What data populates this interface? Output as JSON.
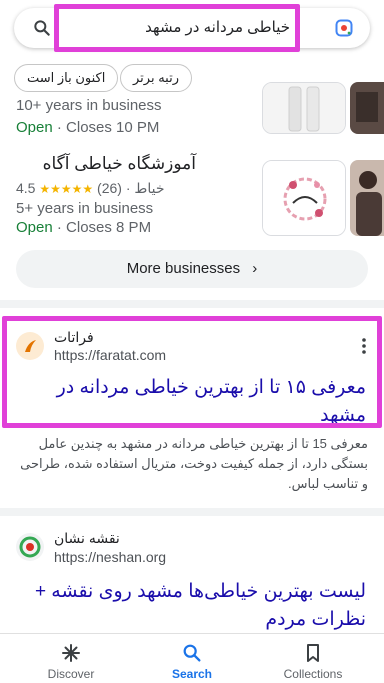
{
  "search": {
    "query": "خیاطی مردانه در مشهد",
    "icon": "search-icon",
    "lens_icon": "google-lens-icon"
  },
  "chips": [
    {
      "label": "اکنون باز است"
    },
    {
      "label": "رتبه برتر"
    }
  ],
  "businesses": [
    {
      "years": "10+ years in business",
      "open_status": "Open",
      "closes": " · Closes 10 PM"
    },
    {
      "name": "آموزشگاه خیاطی آگاه",
      "rating": "4.5",
      "stars": "★★★★★",
      "reviews": "(26)",
      "category": "· خیاط",
      "years": "5+ years in business",
      "open_status": "Open",
      "closes": " · Closes 8 PM"
    }
  ],
  "more_businesses": {
    "label": "More businesses",
    "icon": "chevron-right-icon"
  },
  "results": [
    {
      "site_name": "فراتات",
      "url": "https://faratat.com",
      "title": "معرفی ۱۵ تا از بهترین خیاطی مردانه در مشهد",
      "snippet": "معرفی 15 تا از بهترین خیاطی مردانه در مشهد به چندین عامل بستگی دارد، از جمله کیفیت دوخت، متریال استفاده شده، طراحی و تناسب لباس.",
      "favicon_color": "#e37400"
    },
    {
      "site_name": "نقشه نشان",
      "url": "https://neshan.org",
      "title": "لیست بهترین خیاطی‌ها مشهد روی نقشه + نظرات مردم",
      "favicon_color": "#d93025"
    }
  ],
  "bottom_nav": [
    {
      "label": "Discover",
      "icon": "asterisk-icon"
    },
    {
      "label": "Search",
      "icon": "search-icon"
    },
    {
      "label": "Collections",
      "icon": "bookmark-icon"
    }
  ],
  "colors": {
    "highlight": "#e040d8",
    "link": "#1a0dab",
    "open": "#188038",
    "accent": "#1a73e8",
    "star": "#f4b400"
  }
}
